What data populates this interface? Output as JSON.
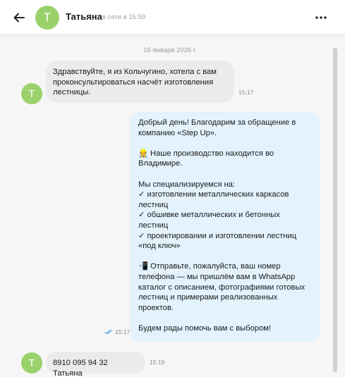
{
  "header": {
    "contact_name": "Татьяна",
    "contact_status": "в сети в 15:59",
    "avatar_letter": "Т"
  },
  "chat": {
    "date_separator": "16 января 2026 г.",
    "messages": [
      {
        "direction": "incoming",
        "avatar_letter": "Т",
        "lines": [
          "Здравствуйте, я из Кольчугино, хотела с вам",
          "проконсультироваться насчёт изготовления",
          "лестницы."
        ],
        "time": "15:17"
      },
      {
        "direction": "outgoing",
        "lines": [
          "Добрый день! Благодарим за обращение в",
          "компанию «Step Up».",
          "",
          "👷 Наше производство находится во",
          "Владимире.",
          "",
          "Мы специализируемся на:",
          "✓ изготовлении металлических каркасов",
          "лестниц",
          "✓ обшивке металлических и бетонных",
          "лестниц",
          "✓ проектировании и изготовлении лестниц",
          "«под ключ»",
          "",
          "📲 Отправьте, пожалуйста, ваш номер",
          "телефона — мы пришлём вам в WhatsApp",
          "каталог с описанием, фотографиями готовых",
          "лестниц и примерами реализованных",
          "проектов.",
          "",
          "Будем рады помочь вам с выбором!"
        ],
        "time": "15:17",
        "read": true
      },
      {
        "direction": "incoming",
        "avatar_letter": "Т",
        "lines": [
          "8910 095 94 32 Татьяна"
        ],
        "time": "15:19"
      }
    ]
  },
  "colors": {
    "avatar": "#9bd16b",
    "incoming_bubble": "#ebebeb",
    "outgoing_bubble": "#e3f2fd",
    "chat_background": "#f6f6f6",
    "read_checks": "#4a9fe0"
  },
  "icons": {
    "back": "arrow-left-icon",
    "more": "more-horizontal-icon",
    "read": "double-check-icon"
  }
}
